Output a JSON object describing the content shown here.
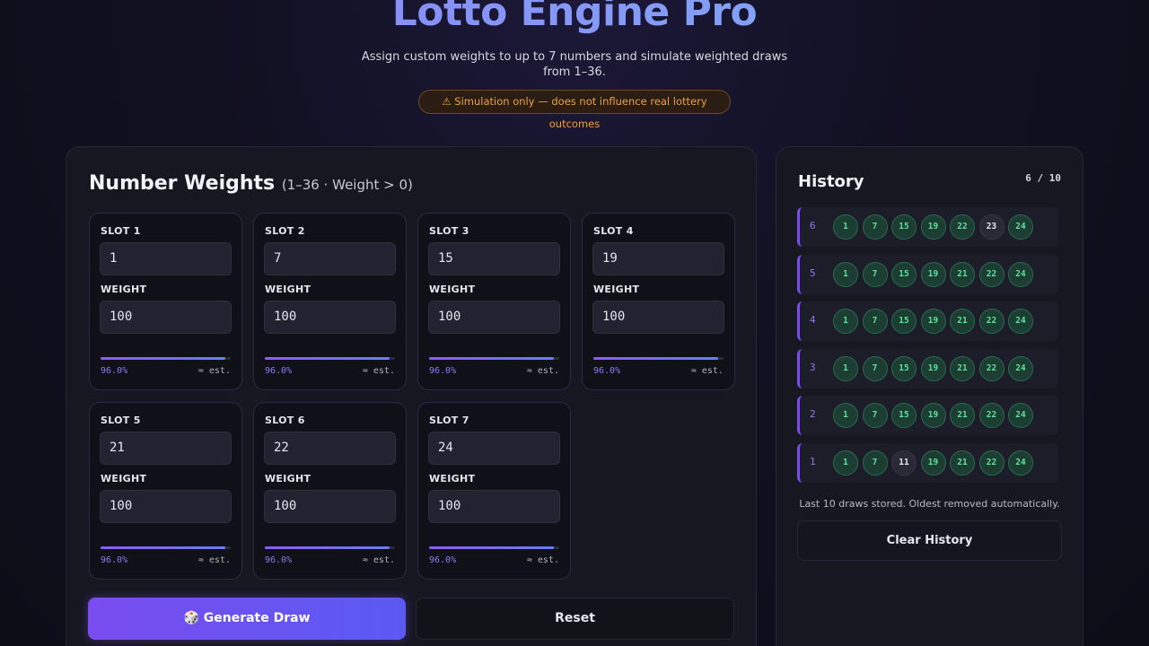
{
  "header": {
    "title": "Lotto Engine Pro",
    "subtitle": "Assign custom weights to up to 7 numbers and simulate weighted draws from 1–36.",
    "disclaimer": "⚠ Simulation only — does not influence real lottery outcomes"
  },
  "weights_panel": {
    "heading": "Number Weights",
    "heading_sub": "(1–36 · Weight > 0)",
    "weight_label": "WEIGHT",
    "est_label": "≈ est.",
    "slots": [
      {
        "label": "SLOT 1",
        "number": "1",
        "weight": "100",
        "pct": "96.0%",
        "bar_fraction": 0.96
      },
      {
        "label": "SLOT 2",
        "number": "7",
        "weight": "100",
        "pct": "96.0%",
        "bar_fraction": 0.96
      },
      {
        "label": "SLOT 3",
        "number": "15",
        "weight": "100",
        "pct": "96.0%",
        "bar_fraction": 0.96
      },
      {
        "label": "SLOT 4",
        "number": "19",
        "weight": "100",
        "pct": "96.0%",
        "bar_fraction": 0.96
      },
      {
        "label": "SLOT 5",
        "number": "21",
        "weight": "100",
        "pct": "96.0%",
        "bar_fraction": 0.96
      },
      {
        "label": "SLOT 6",
        "number": "22",
        "weight": "100",
        "pct": "96.0%",
        "bar_fraction": 0.96
      },
      {
        "label": "SLOT 7",
        "number": "24",
        "weight": "100",
        "pct": "96.0%",
        "bar_fraction": 0.96
      }
    ],
    "generate_label": "🎲 Generate Draw",
    "reset_label": "Reset"
  },
  "history": {
    "title": "History",
    "count": "6 / 10",
    "rows": [
      {
        "index": "6",
        "balls": [
          {
            "n": "1",
            "hit": true
          },
          {
            "n": "7",
            "hit": true
          },
          {
            "n": "15",
            "hit": true
          },
          {
            "n": "19",
            "hit": true
          },
          {
            "n": "22",
            "hit": true
          },
          {
            "n": "23",
            "hit": false
          },
          {
            "n": "24",
            "hit": true
          }
        ]
      },
      {
        "index": "5",
        "balls": [
          {
            "n": "1",
            "hit": true
          },
          {
            "n": "7",
            "hit": true
          },
          {
            "n": "15",
            "hit": true
          },
          {
            "n": "19",
            "hit": true
          },
          {
            "n": "21",
            "hit": true
          },
          {
            "n": "22",
            "hit": true
          },
          {
            "n": "24",
            "hit": true
          }
        ]
      },
      {
        "index": "4",
        "balls": [
          {
            "n": "1",
            "hit": true
          },
          {
            "n": "7",
            "hit": true
          },
          {
            "n": "15",
            "hit": true
          },
          {
            "n": "19",
            "hit": true
          },
          {
            "n": "21",
            "hit": true
          },
          {
            "n": "22",
            "hit": true
          },
          {
            "n": "24",
            "hit": true
          }
        ]
      },
      {
        "index": "3",
        "balls": [
          {
            "n": "1",
            "hit": true
          },
          {
            "n": "7",
            "hit": true
          },
          {
            "n": "15",
            "hit": true
          },
          {
            "n": "19",
            "hit": true
          },
          {
            "n": "21",
            "hit": true
          },
          {
            "n": "22",
            "hit": true
          },
          {
            "n": "24",
            "hit": true
          }
        ]
      },
      {
        "index": "2",
        "balls": [
          {
            "n": "1",
            "hit": true
          },
          {
            "n": "7",
            "hit": true
          },
          {
            "n": "15",
            "hit": true
          },
          {
            "n": "19",
            "hit": true
          },
          {
            "n": "21",
            "hit": true
          },
          {
            "n": "22",
            "hit": true
          },
          {
            "n": "24",
            "hit": true
          }
        ]
      },
      {
        "index": "1",
        "balls": [
          {
            "n": "1",
            "hit": true
          },
          {
            "n": "7",
            "hit": true
          },
          {
            "n": "11",
            "hit": false
          },
          {
            "n": "19",
            "hit": true
          },
          {
            "n": "21",
            "hit": true
          },
          {
            "n": "22",
            "hit": true
          },
          {
            "n": "24",
            "hit": true
          }
        ]
      }
    ],
    "note": "Last 10 draws stored. Oldest removed automatically.",
    "clear_label": "Clear History"
  },
  "colors": {
    "accent": "#7a4cf0",
    "hit_ball": "#5ee0a0",
    "warning": "#f0a040"
  }
}
